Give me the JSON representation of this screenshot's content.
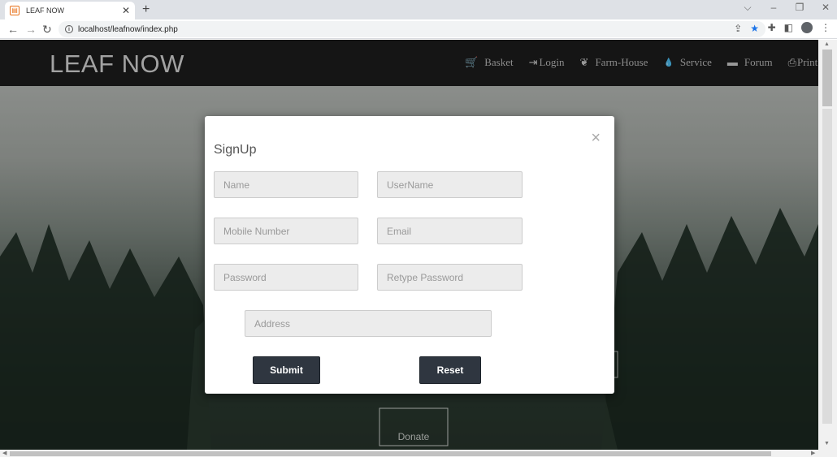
{
  "browser": {
    "tab_title": "LEAF NOW",
    "tab_close": "✕",
    "new_tab": "+",
    "url": "localhost/leafnow/index.php",
    "window_controls": [
      "⌵",
      "–",
      "❐",
      "✕"
    ]
  },
  "site": {
    "brand": "LEAF NOW",
    "nav": [
      {
        "icon": "cart-icon",
        "glyph": "🛒",
        "label": "Basket"
      },
      {
        "icon": "login-icon",
        "glyph": "⇥",
        "label": "Login"
      },
      {
        "icon": "leaf-icon",
        "glyph": "❦",
        "label": "Farm-House"
      },
      {
        "icon": "drop-icon",
        "glyph": "💧",
        "label": "Service"
      },
      {
        "icon": "comment-icon",
        "glyph": "▬",
        "label": "Forum"
      },
      {
        "icon": "print-icon",
        "glyph": "⎙",
        "label": "Print"
      }
    ],
    "hero_button": "Donate"
  },
  "signup": {
    "title": "SignUp",
    "close": "×",
    "fields": {
      "name": "Name",
      "username": "UserName",
      "mobile": "Mobile Number",
      "email": "Email",
      "password": "Password",
      "retype_password": "Retype Password",
      "address": "Address"
    },
    "submit_label": "Submit",
    "reset_label": "Reset"
  },
  "colors": {
    "navbar": "#1c1c1c",
    "button_dark": "#2f3640",
    "star_accent": "#1a73e8"
  }
}
